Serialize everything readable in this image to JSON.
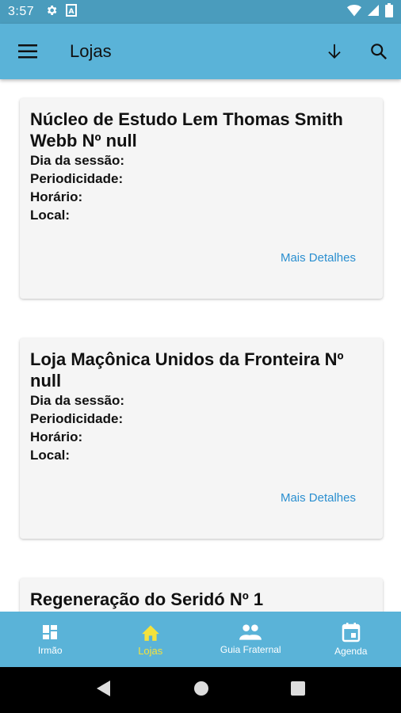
{
  "status_bar": {
    "time": "3:57"
  },
  "app_bar": {
    "title": "Lojas"
  },
  "cards": [
    {
      "title": "Núcleo de Estudo Lem Thomas Smith Webb Nº null",
      "fields": [
        "Dia da sessão:",
        "Periodicidade:",
        "Horário:",
        "Local:"
      ],
      "link": "Mais Detalhes"
    },
    {
      "title": "Loja Maçônica Unidos da Fronteira Nº null",
      "fields": [
        "Dia da sessão:",
        "Periodicidade:",
        "Horário:",
        "Local:"
      ],
      "link": "Mais Detalhes"
    },
    {
      "title": "Regeneração do Seridó Nº 1",
      "fields": [],
      "link": ""
    }
  ],
  "bottom_nav": {
    "items": [
      {
        "label": "Irmão",
        "icon": "dashboard-icon"
      },
      {
        "label": "Lojas",
        "icon": "home-icon",
        "active": true
      },
      {
        "label": "Guia Fraternal",
        "icon": "people-icon"
      },
      {
        "label": "Agenda",
        "icon": "calendar-icon"
      }
    ]
  },
  "colors": {
    "status_bar": "#4a9cbd",
    "app_bar": "#5ab3d8",
    "card_bg": "#f5f5f5",
    "link": "#2a8fd0",
    "active_nav": "#f4e23c"
  }
}
